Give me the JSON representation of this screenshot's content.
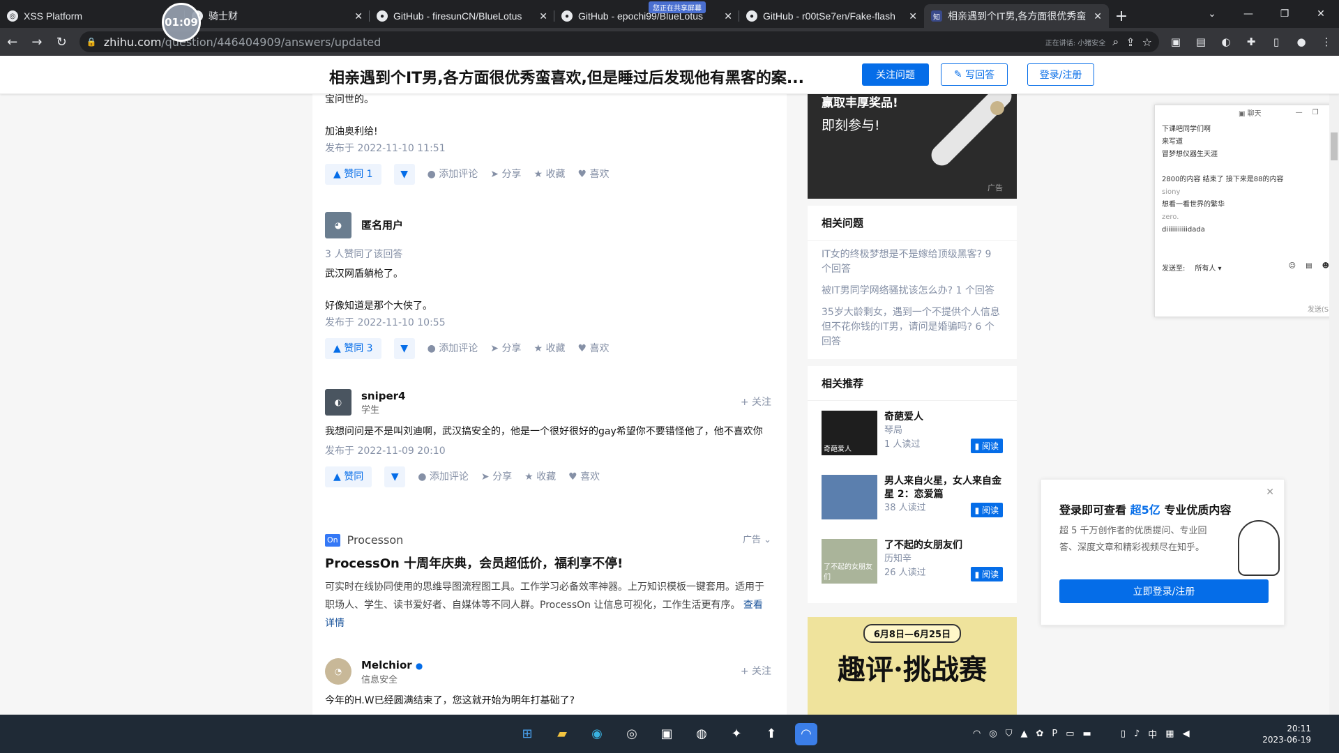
{
  "browser": {
    "tabs": [
      {
        "label": "XSS Platform",
        "icon": "globe-icon"
      },
      {
        "label": "骑士财",
        "icon": "globe-icon"
      },
      {
        "label": "GitHub - firesunCN/BlueLotus",
        "icon": "github-icon"
      },
      {
        "label": "GitHub - epochi99/BlueLotus",
        "icon": "github-icon"
      },
      {
        "label": "GitHub - r00tSe7en/Fake-flash",
        "icon": "github-icon"
      },
      {
        "label": "相亲遇到个IT男,各方面很优秀蛮",
        "icon": "zhihu-icon"
      }
    ],
    "url_host": "zhihu.com",
    "url_path": "/question/446404909/answers/updated",
    "mic_label": "正在讲话: 小猪安全",
    "recording_timer": "01:09",
    "recording_badge": "您正在共享屏幕"
  },
  "header": {
    "question_title": "相亲遇到个IT男,各方面很优秀蛮喜欢,但是睡过后发现他有黑客的案...",
    "follow_label": "关注问题",
    "write_label": "写回答",
    "login_label": "登录/注册"
  },
  "answers": [
    {
      "text_lines": [
        "宝问世的。",
        "加油奥利给!"
      ],
      "published": "发布于 2022-11-10 11:51",
      "vote": "赞同 1"
    },
    {
      "author": "匿名用户",
      "upvoters": "3 人赞同了该回答",
      "text_lines": [
        "武汉网盾躺枪了。",
        "好像知道是那个大侠了。"
      ],
      "published": "发布于 2022-11-10 10:55",
      "vote": "赞同 3"
    },
    {
      "author": "sniper4",
      "bio": "学生",
      "follow": "+ 关注",
      "text": "我想问问是不是叫刘迪啊，武汉搞安全的，他是一个很好很好的gay希望你不要错怪他了，他不喜欢你",
      "published": "发布于 2022-11-09 20:10",
      "vote": "赞同"
    },
    {
      "author": "Melchior",
      "bio": "信息安全",
      "follow": "+ 关注",
      "text": "今年的H.W已经圆满结束了，您这就开始为明年打基础了?"
    }
  ],
  "action_labels": {
    "comment": "添加评论",
    "share": "分享",
    "collect": "收藏",
    "like": "喜欢"
  },
  "ad": {
    "brand": "Processon",
    "brand_badge": "On",
    "tag": "广告",
    "title": "ProcessOn 十周年庆典，会员超低价，福利享不停!",
    "body": "可实时在线协同使用的思维导图流程图工具。工作学习必备效率神器。上万知识模板一键套用。适用于职场人、学生、读书爱好者、自媒体等不同人群。ProcessOn 让信息可视化，工作生活更有序。",
    "more": "查看详情"
  },
  "sidebar": {
    "top_ad_line1": "赢取丰厚奖品!",
    "top_ad_line2": "即刻参与!",
    "top_ad_tag": "广告",
    "related_title": "相关问题",
    "related": [
      "IT女的终极梦想是不是嫁给顶级黑客? 9 个回答",
      "被IT男同学网络骚扰该怎么办? 1 个回答",
      "35岁大龄剩女，遇到一个不提供个人信息但不花你钱的IT男，请问是婚骗吗? 6 个回答"
    ],
    "recommend_title": "相关推荐",
    "books": [
      {
        "title": "奇葩爱人",
        "author": "琴局",
        "reads": "1 人读过",
        "cover": "奇葩爱人"
      },
      {
        "title": "男人来自火星，女人来自金星 2：恋爱篇",
        "author": "",
        "reads": "38 人读过",
        "cover": ""
      },
      {
        "title": "了不起的女朋友们",
        "author": "历知辛",
        "reads": "26 人读过",
        "cover": "了不起的女朋友们"
      }
    ],
    "read_label": "阅读",
    "bottom_ad_date": "6月8日—6月25日",
    "bottom_ad_title": "趣评·挑战赛"
  },
  "chat": {
    "title": "聊天",
    "lines": [
      {
        "text": "下课吧同学们啊",
        "meta": false
      },
      {
        "text": "来写道",
        "meta": false
      },
      {
        "text": "冒梦想仪器生天涯",
        "meta": false
      },
      {
        "text": "2800的内容 结束了 接下来是88的内容",
        "meta": false
      },
      {
        "text": "siony",
        "meta": true
      },
      {
        "text": "想看一看世界的繁华",
        "meta": false
      },
      {
        "text": "zero.",
        "meta": true
      },
      {
        "text": "diiiiiiiiiiidada",
        "meta": false
      }
    ],
    "send_to": "发送至:",
    "all": "所有人",
    "send": "发送(S)"
  },
  "login_popup": {
    "title_pre": "登录即可查看",
    "title_em": "超5亿",
    "title_post": "专业优质内容",
    "desc": "超 5 千万创作者的优质提问、专业回答、深度文章和精彩视频尽在知乎。",
    "button": "立即登录/注册"
  },
  "taskbar": {
    "apps": [
      "start-icon",
      "file-explorer-icon",
      "edge-icon",
      "chrome-icon",
      "app-icon",
      "app-icon",
      "app-icon",
      "app-icon",
      "app-icon"
    ],
    "ime": "中",
    "time": "20:11",
    "date": "2023-06-19"
  }
}
